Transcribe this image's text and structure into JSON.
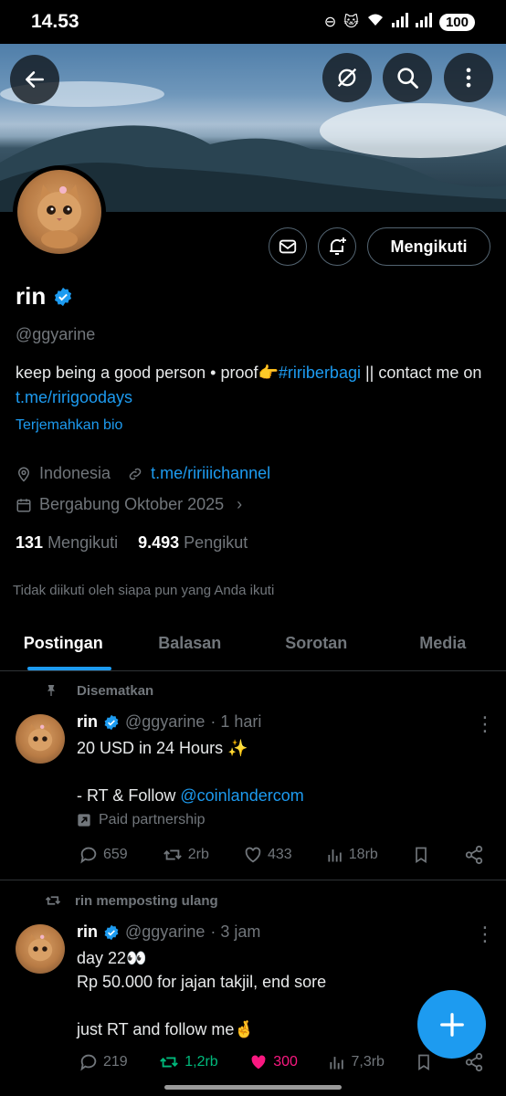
{
  "status_bar": {
    "time": "14.53",
    "battery": "100"
  },
  "profile": {
    "name": "rin",
    "handle": "@ggyarine",
    "bio_text": "keep being a good person • proof👉",
    "bio_hashtag": "#ririberbagi",
    "bio_text2": " || contact me on ",
    "bio_link": "t.me/ririgoodays",
    "translate_bio": "Terjemahkan bio",
    "location": "Indonesia",
    "website": "t.me/ririiichannel",
    "joined": "Bergabung Oktober 2025",
    "following_count": "131",
    "following_label": "Mengikuti",
    "followers_count": "9.493",
    "followers_label": "Pengikut",
    "not_followed": "Tidak diikuti oleh siapa pun yang Anda ikuti",
    "follow_button": "Mengikuti"
  },
  "tabs": [
    {
      "label": "Postingan",
      "active": true
    },
    {
      "label": "Balasan",
      "active": false
    },
    {
      "label": "Sorotan",
      "active": false
    },
    {
      "label": "Media",
      "active": false
    }
  ],
  "posts": [
    {
      "context": "Disematkan",
      "name": "rin",
      "handle": "@ggyarine",
      "time": "· 1 hari",
      "text": "20 USD in 24 Hours ✨\n\n- RT & Follow ",
      "mention": "@coinlandercom",
      "paid": "Paid partnership",
      "replies": "659",
      "reposts": "2rb",
      "likes": "433",
      "views": "18rb"
    },
    {
      "context": "rin memposting ulang",
      "name": "rin",
      "handle": "@ggyarine",
      "time": "· 3 jam",
      "text": "day 22👀\nRp 50.000 for jajan takjil, end sore\n\njust RT and follow me🤞",
      "replies": "219",
      "reposts": "1,2rb",
      "likes": "300",
      "views": "7,3rb"
    }
  ],
  "colors": {
    "accent": "#1d9bf0",
    "repost_active": "#00ba7c",
    "like_active": "#f91880"
  }
}
